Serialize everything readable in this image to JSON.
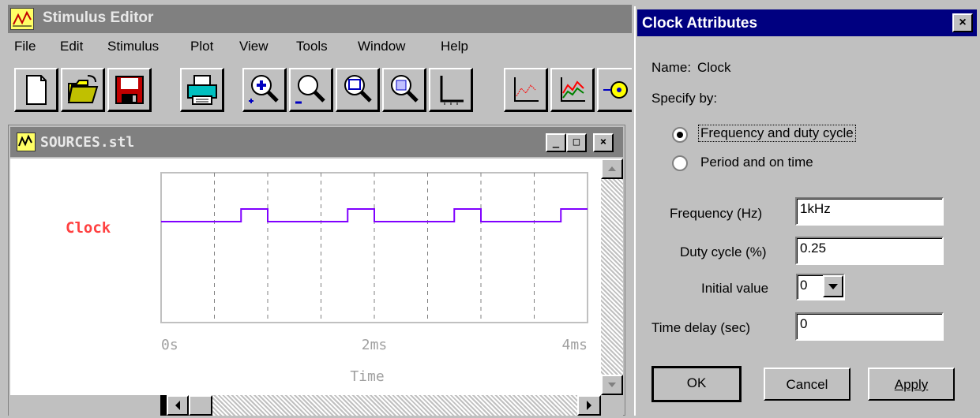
{
  "main_window": {
    "title": "Stimulus Editor",
    "menu": [
      "File",
      "Edit",
      "Stimulus",
      "Plot",
      "View",
      "Tools",
      "Window",
      "Help"
    ],
    "toolbar": [
      "new-file-icon",
      "open-folder-icon",
      "save-disk-icon",
      "print-icon",
      "zoom-in-icon",
      "zoom-out-icon",
      "zoom-area-icon",
      "zoom-fit-icon",
      "axis-settings-icon",
      "add-trace-icon",
      "add-plot-icon",
      "add-marker-icon"
    ]
  },
  "child_window": {
    "title": "SOURCES.stl",
    "caption_buttons": [
      "_",
      "□",
      "×"
    ]
  },
  "chart_data": {
    "type": "line",
    "series": [
      {
        "name": "Clock",
        "color": "#8000ff",
        "x": [
          0,
          0.75,
          0.75,
          1.0,
          1.0,
          1.75,
          1.75,
          2.0,
          2.0,
          2.75,
          2.75,
          3.0,
          3.0,
          3.75,
          3.75,
          4.0
        ],
        "y": [
          0,
          0,
          1,
          1,
          0,
          0,
          1,
          1,
          0,
          0,
          1,
          1,
          0,
          0,
          1,
          1
        ]
      }
    ],
    "signal_label_color": "#ff4040",
    "xlabel": "Time",
    "xlim": [
      0,
      4
    ],
    "ylim": [
      0,
      1
    ],
    "x_ticks": [
      0,
      2,
      4
    ],
    "x_tick_labels": [
      "0s",
      "2ms",
      "4ms"
    ],
    "grid": true
  },
  "dialog": {
    "title": "Clock Attributes",
    "close": "×",
    "name_label": "Name:",
    "name_value": "Clock",
    "specify_by": "Specify by:",
    "radio_freq": "Frequency and duty cycle",
    "radio_period": "Period and on time",
    "selected": "Frequency and duty cycle",
    "freq_label": "Frequency (Hz)",
    "freq_value": "1kHz",
    "duty_label": "Duty cycle (%)",
    "duty_value": "0.25",
    "init_label": "Initial value",
    "init_value": "0",
    "delay_label": "Time delay (sec)",
    "delay_value": "0",
    "ok": "OK",
    "cancel": "Cancel",
    "apply": "Apply"
  }
}
